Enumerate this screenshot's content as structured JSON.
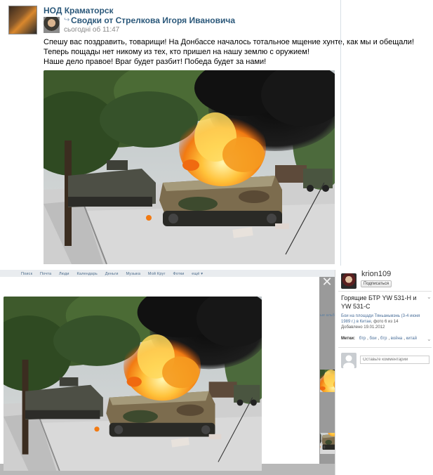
{
  "post": {
    "group_name": "НОД Краматорск",
    "repost_title": "Сводки от Стрелкова Игоря Ивановича",
    "repost_time": "сьогодні об 11:47",
    "text_lines": [
      "Спешу вас поздравить, товарищи! На Донбассе началось тотальное мщение хунте, как мы и обещали!",
      "Теперь пощады нет никому из тех, кто пришел на нашу землю с оружием!",
      "Наше дело правое! Враг будет разбит! Победа будет за нами!"
    ]
  },
  "viewer": {
    "menu_items": [
      "Поиск",
      "Почта",
      "Люди",
      "Календарь",
      "Деньги",
      "Музыка",
      "Мой Круг",
      "Фотки",
      "ещё ▾"
    ],
    "close_symbol": "✕",
    "side_link": "ые альбо"
  },
  "sidebar": {
    "author_name": "krion109",
    "subscribe_label": "Подписаться",
    "photo_title": "Горящие БТР YW 531-H и YW 531-C",
    "album_link": "Бои на площади Тяньаньмэнь (3-4 июня 1989 г.) в Китае",
    "photo_counter": "фото 6 из 14",
    "added_date": "Добавлено 19.01.2012",
    "tags_label": "Метки:",
    "tags": [
      "бтр",
      "бои",
      "бтр",
      "война",
      "китай"
    ],
    "comment_placeholder": "Оставьте комментарий"
  },
  "colors": {
    "link_blue": "#2b587a",
    "fire_orange": "#f28a1c",
    "smoke_black": "#141414",
    "foliage_green": "#3e5a2c"
  }
}
